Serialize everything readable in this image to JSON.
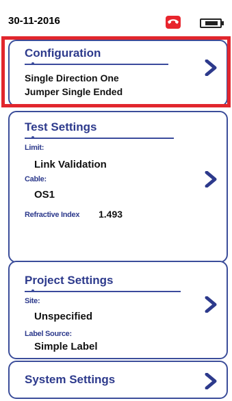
{
  "status_bar": {
    "date": "30-11-2016",
    "icons": [
      "phone-hangup-icon",
      "battery-icon"
    ],
    "accent_red": "#e1262d"
  },
  "cards": {
    "configuration": {
      "title": "Configuration",
      "line1": "Single Direction One",
      "line2": "Jumper Single Ended"
    },
    "test_settings": {
      "title": "Test Settings",
      "limit_label": "Limit:",
      "limit_value": "Link Validation",
      "cable_label": "Cable:",
      "cable_value": "OS1",
      "refractive_label": "Refractive Index",
      "refractive_value": "1.493"
    },
    "project_settings": {
      "title": "Project Settings",
      "site_label": "Site:",
      "site_value": "Unspecified",
      "label_source_label": "Label Source:",
      "label_source_value": "Simple Label"
    },
    "system_settings": {
      "title": "System Settings"
    }
  },
  "colors": {
    "title_blue": "#2d3a8c",
    "border_blue": "#3b4d9a",
    "chevron_blue": "#2d3a8c"
  }
}
